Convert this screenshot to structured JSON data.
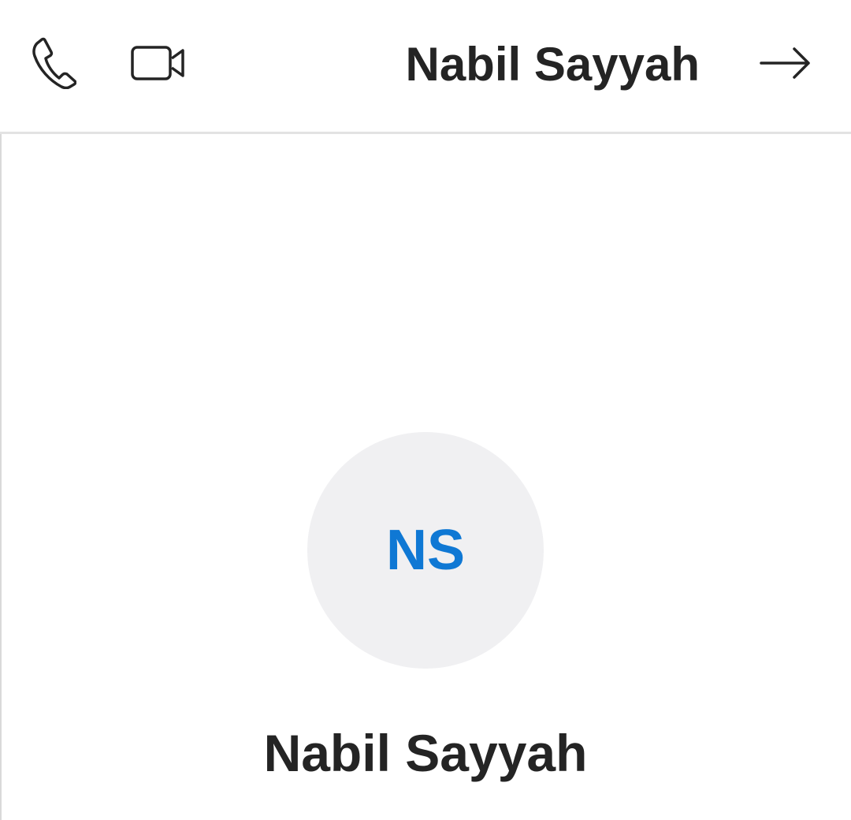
{
  "header": {
    "title": "Nabil Sayyah",
    "call_icon": "phone-icon",
    "video_icon": "video-camera-icon",
    "forward_icon": "arrow-right-icon"
  },
  "profile": {
    "initials": "NS",
    "name": "Nabil Sayyah"
  },
  "colors": {
    "accent": "#0f78d4",
    "text": "#242424",
    "avatar_background": "#f0f0f2",
    "divider": "#e3e3e3"
  }
}
